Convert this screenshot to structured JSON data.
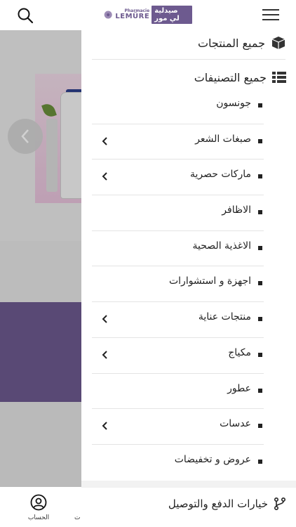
{
  "header": {
    "logo_small": "Pharmacie",
    "logo_big": "LEMÜRE",
    "logo_arabic": "صيدلية لي مور"
  },
  "drawer": {
    "all_products": "جميع المنتجات",
    "all_categories": "جميع التصنيفات",
    "categories": [
      {
        "label": "جونسون",
        "has_children": false
      },
      {
        "label": "صبغات الشعر",
        "has_children": true
      },
      {
        "label": "ماركات حصرية",
        "has_children": true
      },
      {
        "label": "الاظافر",
        "has_children": false
      },
      {
        "label": "الاغذية الصحية",
        "has_children": false
      },
      {
        "label": "اجهزة و استشوارات",
        "has_children": false
      },
      {
        "label": "منتجات عناية",
        "has_children": true
      },
      {
        "label": "مكياج",
        "has_children": true
      },
      {
        "label": "عطور",
        "has_children": false
      },
      {
        "label": "عدسات",
        "has_children": true
      },
      {
        "label": "عروض و تخفيضات",
        "has_children": false
      }
    ],
    "payment_delivery": "خيارات الدفع والتوصيل"
  },
  "bottom_nav": {
    "account_label": "الحساب",
    "partial_label": "ت"
  },
  "colors": {
    "brand_purple": "#6d5a8f",
    "drawer_bg": "#ffffff",
    "divider": "#e4e4e4"
  }
}
